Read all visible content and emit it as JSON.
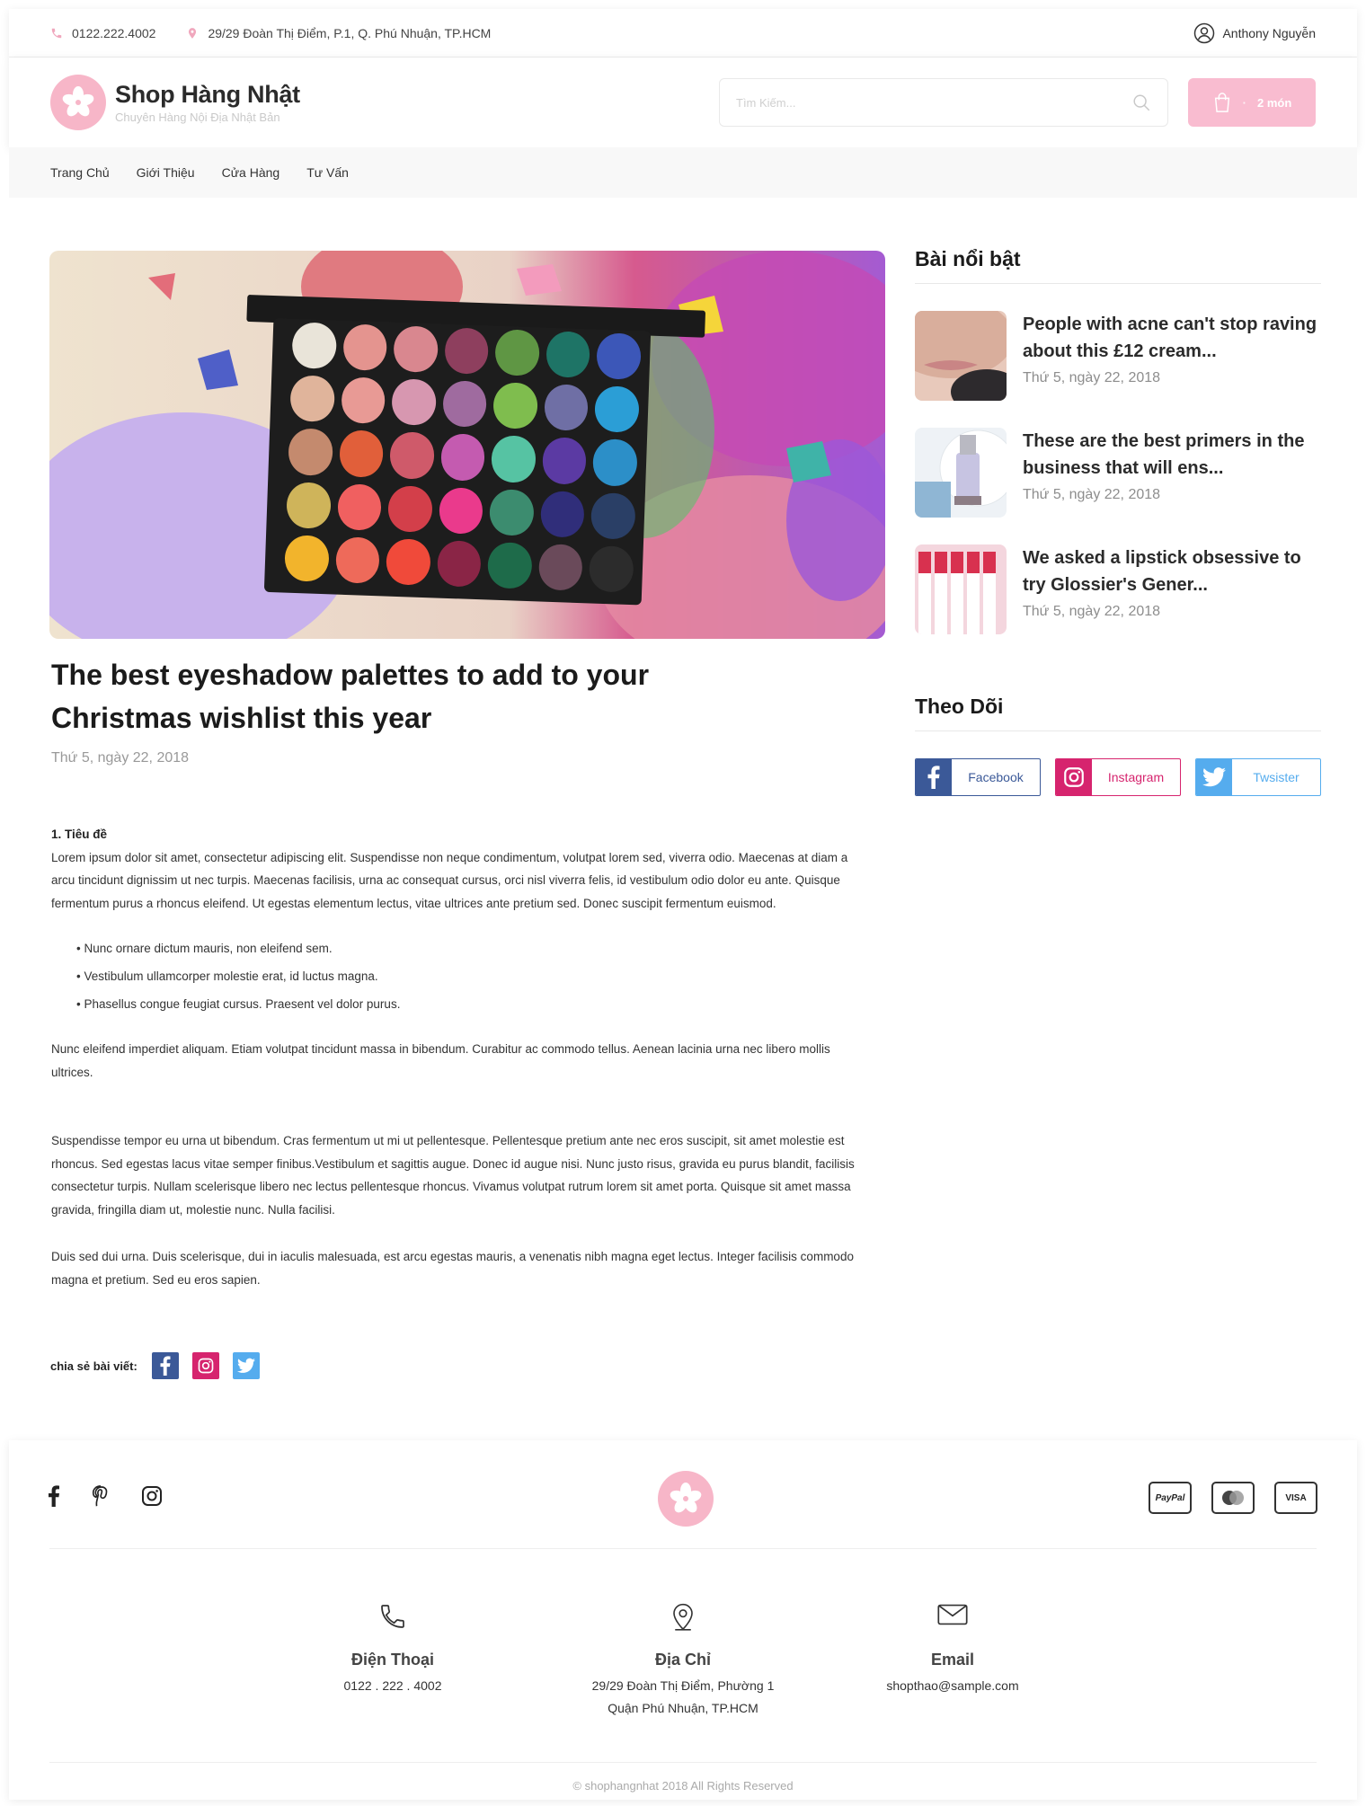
{
  "topbar": {
    "phone": "0122.222.4002",
    "address": "29/29 Đoàn Thị Điểm, P.1, Q. Phú Nhuận, TP.HCM",
    "user": "Anthony Nguyễn"
  },
  "header": {
    "brand_name": "Shop Hàng Nhật",
    "brand_tagline": "Chuyên Hàng Nội Địa Nhật Bản",
    "search_placeholder": "Tìm Kiếm...",
    "cart_label": "2 món"
  },
  "nav": [
    "Trang Chủ",
    "Giới Thiệu",
    "Cửa Hàng",
    "Tư Vấn"
  ],
  "article": {
    "title": "The best eyeshadow palettes to add to your Christmas wishlist this year",
    "date": "Thứ 5, ngày 22, 2018",
    "section_heading": "1. Tiêu đề",
    "p1": "Lorem ipsum dolor sit amet, consectetur adipiscing elit. Suspendisse non neque condimentum, volutpat lorem sed, viverra odio. Maecenas at diam a arcu tincidunt dignissim ut nec turpis. Maecenas facilisis, urna ac consequat cursus, orci nisl viverra felis, id vestibulum odio dolor eu ante. Quisque fermentum purus a rhoncus eleifend. Ut egestas elementum lectus, vitae ultrices ante pretium sed. Donec suscipit fermentum euismod.",
    "bullets": [
      "Nunc ornare dictum mauris, non eleifend sem.",
      "Vestibulum ullamcorper molestie erat, id luctus magna.",
      "Phasellus congue feugiat cursus. Praesent vel dolor purus."
    ],
    "p2": "Nunc eleifend imperdiet aliquam. Etiam volutpat tincidunt massa in bibendum. Curabitur ac commodo tellus. Aenean lacinia urna nec libero mollis ultrices.",
    "p3": "Suspendisse tempor eu urna ut bibendum. Cras fermentum ut mi ut pellentesque. Pellentesque pretium ante nec eros suscipit, sit amet molestie est rhoncus. Sed egestas lacus vitae semper finibus.Vestibulum et sagittis augue. Donec id augue nisi. Nunc justo risus, gravida eu purus blandit, facilisis consectetur turpis. Nullam scelerisque libero nec lectus pellentesque rhoncus. Vivamus volutpat rutrum lorem sit amet porta. Quisque sit amet massa gravida, fringilla diam ut, molestie nunc. Nulla facilisi.",
    "p4": " Duis sed dui urna. Duis scelerisque, dui in iaculis malesuada, est arcu egestas mauris, a venenatis nibh magna eget lectus. Integer facilisis commodo magna et pretium. Sed eu eros sapien.",
    "share_label": "chia sẻ bài viết:"
  },
  "sidebar": {
    "featured_heading": "Bài nổi bật",
    "posts": [
      {
        "title": "People with acne can't stop raving about this £12 cream...",
        "date": "Thứ 5, ngày 22, 2018"
      },
      {
        "title": "These are the best primers in the business that will ens...",
        "date": "Thứ 5, ngày 22, 2018"
      },
      {
        "title": "We asked a lipstick obsessive to try Glossier's Gener...",
        "date": "Thứ 5, ngày 22, 2018"
      }
    ],
    "follow_heading": "Theo Dõi",
    "follow": [
      {
        "label": "Facebook",
        "color": "#3b5998"
      },
      {
        "label": "Instagram",
        "color": "#d6246e"
      },
      {
        "label": "Twsister",
        "color": "#55acee"
      }
    ]
  },
  "footer": {
    "payments": [
      "PayPal",
      "VISA"
    ],
    "phone_title": "Điện Thoại",
    "phone_value": "0122 . 222 . 4002",
    "address_title": "Địa Chỉ",
    "address_line1": "29/29 Đoàn Thị Điểm, Phường 1",
    "address_line2": "Quận Phú Nhuận, TP.HCM",
    "email_title": "Email",
    "email_value": "shopthao@sample.com",
    "copyright": "© shophangnhat 2018 All Rights Reserved"
  },
  "colors": {
    "pink": "#f7b6c8",
    "cart": "#f9bcd0",
    "facebook": "#3b5998",
    "instagram": "#d6246e",
    "twitter": "#55acee"
  },
  "icons": [
    "phone-icon",
    "location-icon",
    "user-icon",
    "search-icon",
    "cart-icon",
    "sakura-icon",
    "facebook-icon",
    "instagram-icon",
    "twitter-icon",
    "pinterest-icon",
    "mail-icon"
  ]
}
